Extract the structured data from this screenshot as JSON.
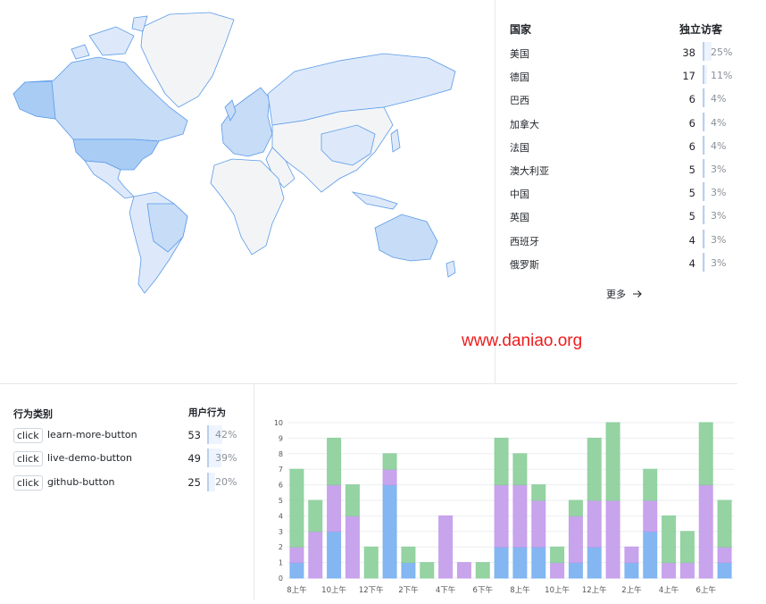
{
  "map": {
    "regions": [
      {
        "name": "United States",
        "visitors": 38
      },
      {
        "name": "Canada",
        "visitors": 6
      },
      {
        "name": "Brazil",
        "visitors": 6
      },
      {
        "name": "Russia",
        "visitors": 4
      },
      {
        "name": "Greenland",
        "visitors": 0
      }
    ],
    "colors": {
      "high": "#a9ccf5",
      "mid": "#c6dcf7",
      "low": "#dde9fa",
      "none": "#f3f4f6",
      "stroke": "#5a9ae8"
    }
  },
  "countries": {
    "header_country": "国家",
    "header_visitors": "独立访客",
    "rows": [
      {
        "name": "美国",
        "value": "38",
        "percent": "25%",
        "share": 25
      },
      {
        "name": "德国",
        "value": "17",
        "percent": "11%",
        "share": 11
      },
      {
        "name": "巴西",
        "value": "6",
        "percent": "4%",
        "share": 4
      },
      {
        "name": "加拿大",
        "value": "6",
        "percent": "4%",
        "share": 4
      },
      {
        "name": "法国",
        "value": "6",
        "percent": "4%",
        "share": 4
      },
      {
        "name": "澳大利亚",
        "value": "5",
        "percent": "3%",
        "share": 3
      },
      {
        "name": "中国",
        "value": "5",
        "percent": "3%",
        "share": 3
      },
      {
        "name": "英国",
        "value": "5",
        "percent": "3%",
        "share": 3
      },
      {
        "name": "西班牙",
        "value": "4",
        "percent": "3%",
        "share": 3
      },
      {
        "name": "俄罗斯",
        "value": "4",
        "percent": "3%",
        "share": 3
      }
    ],
    "more_label": "更多",
    "more_icon": "arrow-right-icon"
  },
  "watermark": "www.daniao.org",
  "actions": {
    "header_category": "行为类别",
    "header_count": "用户行为",
    "rows": [
      {
        "tag": "click",
        "name": "learn-more-button",
        "value": "53",
        "percent": "42%",
        "share": 42
      },
      {
        "tag": "click",
        "name": "live-demo-button",
        "value": "49",
        "percent": "39%",
        "share": 39
      },
      {
        "tag": "click",
        "name": "github-button",
        "value": "25",
        "percent": "20%",
        "share": 20
      }
    ]
  },
  "chart_data": {
    "type": "bar",
    "stacked": true,
    "ylim": [
      0,
      10
    ],
    "yticks": [
      "0",
      "1",
      "2",
      "3",
      "4",
      "5",
      "6",
      "7",
      "8",
      "9",
      "10"
    ],
    "xticklabels": [
      "8上午",
      "10上午",
      "12下午",
      "2下午",
      "4下午",
      "6下午",
      "8上午",
      "10上午",
      "12上午",
      "2上午",
      "4上午",
      "6上午"
    ],
    "grid": true,
    "legend": "none",
    "series": [
      {
        "color": "#7ab1f1",
        "values": [
          1,
          0,
          3,
          0,
          0,
          6,
          1,
          0,
          0,
          0,
          0,
          2,
          2,
          2,
          0,
          1,
          2,
          0,
          1,
          3,
          0,
          0,
          0,
          1
        ]
      },
      {
        "color": "#c39cea",
        "values": [
          1,
          3,
          3,
          4,
          0,
          1,
          0,
          0,
          4,
          1,
          0,
          4,
          4,
          3,
          1,
          3,
          3,
          5,
          1,
          2,
          1,
          1,
          6,
          1
        ]
      },
      {
        "color": "#8ccf9b",
        "values": [
          5,
          2,
          3,
          2,
          2,
          1,
          1,
          1,
          0,
          0,
          1,
          3,
          2,
          1,
          1,
          1,
          4,
          5,
          0,
          2,
          3,
          2,
          4,
          3
        ]
      }
    ]
  }
}
